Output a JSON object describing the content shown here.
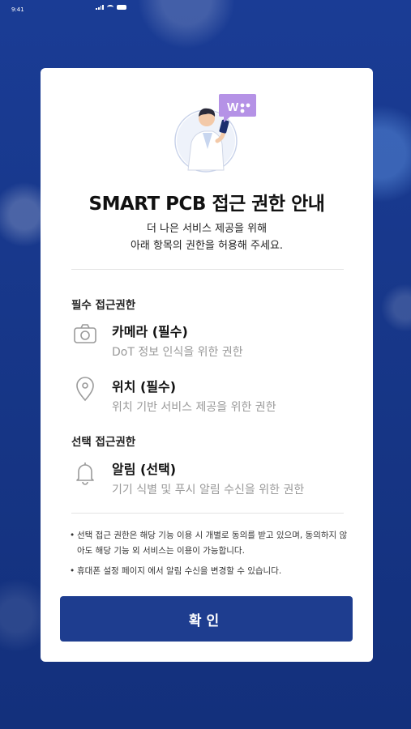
{
  "status_bar": {
    "time": "9:41"
  },
  "dialog": {
    "title": "SMART PCB 접근 권한 안내",
    "subtitle_line1": "더 나은 서비스 제공을 위해",
    "subtitle_line2": "아래 항목의 권한을 허용해 주세요.",
    "required_section_label": "필수 접근권한",
    "optional_section_label": "선택 접근권한",
    "permissions": [
      {
        "icon": "camera-icon",
        "name": "카메라 (필수)",
        "description": "DoT 정보 인식을 위한 권한"
      },
      {
        "icon": "location-pin-icon",
        "name": "위치 (필수)",
        "description": "위치 기반 서비스 제공을 위한 권한"
      },
      {
        "icon": "bell-icon",
        "name": "알림 (선택)",
        "description": "기기 식별 및 푸시 알림 수신을 위한 권한"
      }
    ],
    "notes": [
      "선택 접근 권한은 해당 기능 이용 시 개별로 동의를 받고 있으며, 동의하지 않아도 해당 기능 외 서비스는 이용이 가능합니다.",
      "휴대폰 설정 페이지 에서 알림 수신을 변경할 수 있습니다."
    ],
    "confirm_label": "확인"
  },
  "colors": {
    "background": "#17378f",
    "button": "#1e3d8f",
    "badge": "#b592e6"
  }
}
